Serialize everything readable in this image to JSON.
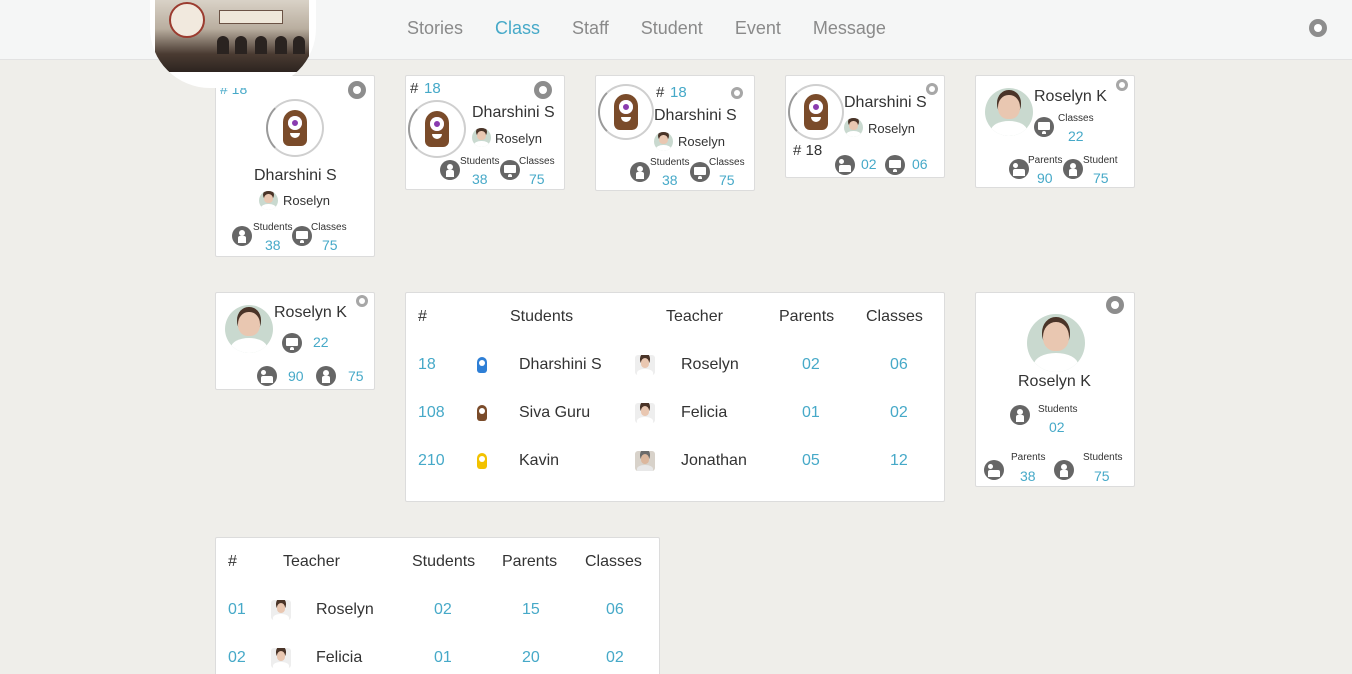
{
  "nav": {
    "tabs": [
      "Stories",
      "Class",
      "Staff",
      "Student",
      "Event",
      "Message"
    ],
    "active": "Class"
  },
  "colors": {
    "accent": "#46a9c8",
    "icon": "#666666",
    "background": "#efeeea"
  },
  "card1": {
    "num": "# 18",
    "name": "Dharshini S",
    "teacher": "Roselyn",
    "students_label": "Students",
    "students": "38",
    "classes_label": "Classes",
    "classes": "75"
  },
  "card2": {
    "hash": "#",
    "num": "18",
    "name": "Dharshini S",
    "teacher": "Roselyn",
    "students_label": "Students",
    "students": "38",
    "classes_label": "Classes",
    "classes": "75"
  },
  "card3": {
    "hash": "#",
    "num": "18",
    "name": "Dharshini S",
    "teacher": "Roselyn",
    "students_label": "Students",
    "students": "38",
    "classes_label": "Classes",
    "classes": "75"
  },
  "card4": {
    "name": "Dharshini S",
    "teacher": "Roselyn",
    "num": "# 18",
    "parents": "02",
    "classes": "06"
  },
  "card5": {
    "name": "Roselyn K",
    "classes_label": "Classes",
    "classes": "22",
    "parents_label": "Parents",
    "parents": "90",
    "student_label": "Student",
    "student": "75"
  },
  "card6": {
    "name": "Roselyn K",
    "classes": "22",
    "parents": "90",
    "students": "75"
  },
  "card7": {
    "name": "Roselyn K",
    "students_label": "Students",
    "students": "02",
    "parents_label": "Parents",
    "parents": "38",
    "students2_label": "Students",
    "students2": "75"
  },
  "class_table": {
    "headers": [
      "#",
      "Students",
      "Teacher",
      "Parents",
      "Classes"
    ],
    "rows": [
      {
        "id": "18",
        "student": "Dharshini S",
        "teacher": "Roselyn",
        "parents": "02",
        "classes": "06"
      },
      {
        "id": "108",
        "student": "Siva Guru",
        "teacher": "Felicia",
        "parents": "01",
        "classes": "02"
      },
      {
        "id": "210",
        "student": "Kavin",
        "teacher": "Jonathan",
        "parents": "05",
        "classes": "12"
      }
    ]
  },
  "teacher_table": {
    "headers": [
      "#",
      "Teacher",
      "Students",
      "Parents",
      "Classes"
    ],
    "rows": [
      {
        "id": "01",
        "teacher": "Roselyn",
        "students": "02",
        "parents": "15",
        "classes": "06"
      },
      {
        "id": "02",
        "teacher": "Felicia",
        "students": "01",
        "parents": "20",
        "classes": "02"
      }
    ]
  }
}
